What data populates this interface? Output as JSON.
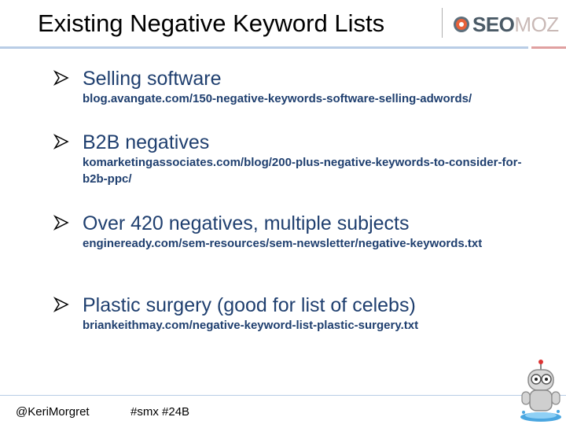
{
  "slide": {
    "title": "Existing Negative Keyword Lists",
    "logo": {
      "text_bold": "SEO",
      "text_light": "MOZ"
    }
  },
  "bullets": [
    {
      "title": "Selling software",
      "url": "blog.avangate.com/150-negative-keywords-software-selling-adwords/"
    },
    {
      "title": "B2B negatives",
      "url": "komarketingassociates.com/blog/200-plus-negative-keywords-to-consider-for-b2b-ppc/"
    },
    {
      "title": "Over 420 negatives, multiple subjects",
      "url": "engineready.com/sem-resources/sem-newsletter/negative-keywords.txt"
    },
    {
      "title": "Plastic surgery (good for list of celebs)",
      "url": "briankeithmay.com/negative-keyword-list-plastic-surgery.txt"
    }
  ],
  "footer": {
    "handle": "@KeriMorgret",
    "hashtags": "#smx #24B"
  },
  "colors": {
    "text_blue": "#1f3f6f",
    "rule_blue": "#b9cde6",
    "rule_red": "#e0a0a0"
  }
}
